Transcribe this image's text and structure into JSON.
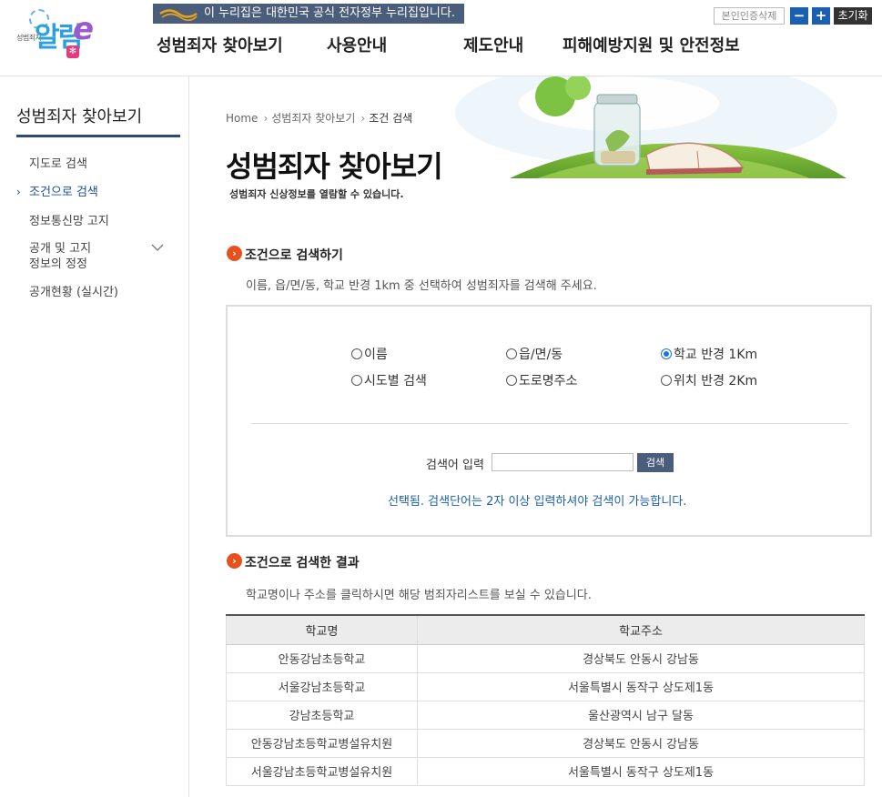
{
  "header": {
    "logo_small_text": "성범죄자",
    "logo_main_text": "알림",
    "logo_suffix": "e",
    "gov_banner_text": "이 누리집은 대한민국 공식 전자정부 누리집입니다.",
    "gov_logo_text": "eG",
    "nav": [
      {
        "label": "성범죄자 찾아보기"
      },
      {
        "label": "사용안내"
      },
      {
        "label": "제도안내"
      },
      {
        "label": "피해예방지원 및 안전정보"
      }
    ],
    "unverify_label": "본인인증삭제",
    "zoom_out_label": "−",
    "zoom_in_label": "+",
    "reset_label": "초기화"
  },
  "sidebar": {
    "title": "성범죄자 찾아보기",
    "items": [
      {
        "label": "지도로 검색"
      },
      {
        "label": "조건으로 검색"
      },
      {
        "label": "정보통신망 고지"
      },
      {
        "label": "공개 및 고지 정보의 정정"
      },
      {
        "label": "공개현황 (실시간)"
      }
    ]
  },
  "breadcrumb": {
    "home": "Home",
    "level1": "성범죄자 찾아보기",
    "level2": "조건 검색"
  },
  "page": {
    "title": "성범죄자 찾아보기",
    "subtitle": "성범죄자 신상정보를 열람할 수 있습니다."
  },
  "search_section": {
    "title": "조건으로 검색하기",
    "description": "이름, 읍/면/동, 학교 반경 1km 중 선택하여 성범죄자를 검색해 주세요.",
    "options": [
      {
        "label": "이름",
        "checked": false
      },
      {
        "label": "읍/면/동",
        "checked": false
      },
      {
        "label": "학교 반경 1Km",
        "checked": true
      },
      {
        "label": "시도별 검색",
        "checked": false
      },
      {
        "label": "도로명주소",
        "checked": false
      },
      {
        "label": "위치 반경 2Km",
        "checked": false
      }
    ],
    "input_label": "검색어 입력",
    "input_value": "",
    "button_label": "검색",
    "hint": "선택됨. 검색단어는 2자 이상 입력하셔야 검색이 가능합니다."
  },
  "results_section": {
    "title": "조건으로 검색한 결과",
    "description": "학교명이나 주소를 클릭하시면 해당 범죄자리스트를 보실 수 있습니다.",
    "columns": [
      "학교명",
      "학교주소"
    ],
    "rows": [
      [
        "안동강남초등학교",
        "경상북도 안동시 강남동"
      ],
      [
        "서울강남초등학교",
        "서울특별시 동작구 상도제1동"
      ],
      [
        "강남초등학교",
        "울산광역시 남구 달동"
      ],
      [
        "안동강남초등학교병설유치원",
        "경상북도 안동시 강남동"
      ],
      [
        "서울강남초등학교병설유치원",
        "서울특별시 동작구 상도제1동"
      ]
    ]
  },
  "colors": {
    "accent_orange": "#e8501e",
    "nav_blue": "#1b5fb3",
    "hint_blue": "#1b5fb3",
    "banner_bg": "#4a5d7a"
  }
}
